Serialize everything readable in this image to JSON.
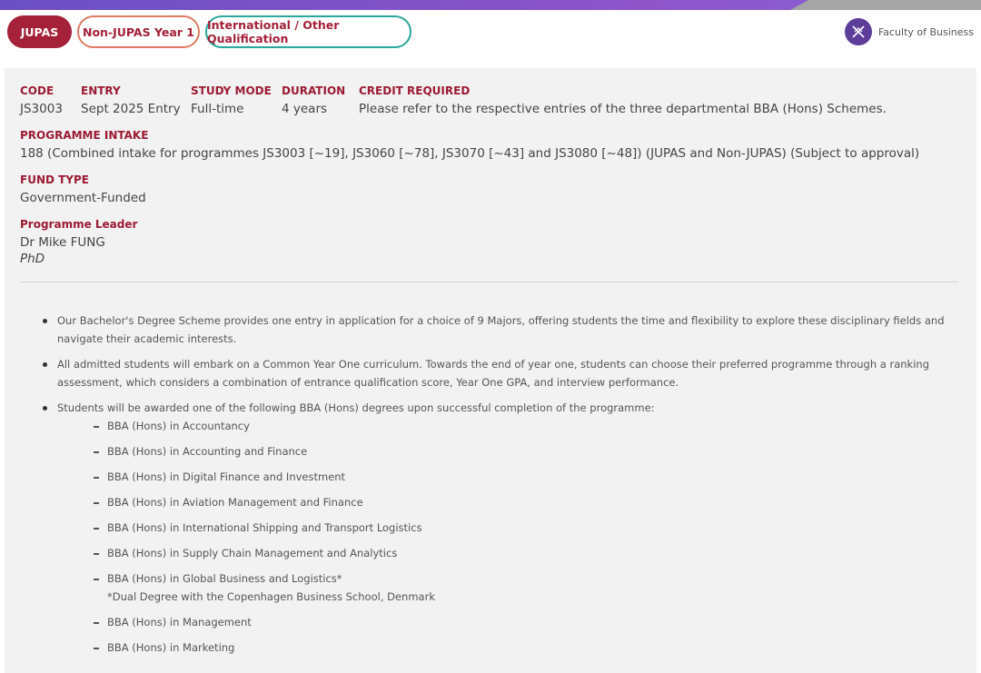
{
  "tabs": [
    {
      "label": "JUPAS"
    },
    {
      "label": "Non-JUPAS Year 1"
    },
    {
      "label": "International / Other Qualification"
    }
  ],
  "faculty": {
    "name": "Faculty of Business"
  },
  "programme": {
    "code_label": "CODE",
    "code": "JS3003",
    "entry_label": "ENTRY",
    "entry": "Sept 2025 Entry",
    "mode_label": "STUDY MODE",
    "mode": "Full-time",
    "duration_label": "DURATION",
    "duration": "4 years",
    "credit_label": "CREDIT REQUIRED",
    "credit": "Please refer to the respective entries of the three departmental BBA (Hons) Schemes.",
    "intake_label": "PROGRAMME INTAKE",
    "intake": "188 (Combined intake for programmes JS3003 [~19], JS3060 [~78], JS3070 [~43] and JS3080 [~48]) (JUPAS and Non-JUPAS) (Subject to approval)",
    "fund_label": "FUND TYPE",
    "fund": "Government-Funded",
    "leader_label": "Programme Leader",
    "leader": "Dr Mike FUNG",
    "leader_title": "PhD"
  },
  "bullets": [
    "Our Bachelor's Degree Scheme provides one entry in application for a choice of 9 Majors, offering students the time and flexibility to explore these disciplinary fields and navigate their academic interests.",
    "All admitted students will embark on a Common Year One curriculum. Towards the end of year one, students can choose their preferred programme through a ranking assessment, which considers a combination of entrance qualification score, Year One GPA, and interview performance.",
    "Students will be awarded one of the following BBA (Hons) degrees upon successful completion of the programme:"
  ],
  "degrees": [
    "BBA (Hons) in Accountancy",
    "BBA (Hons) in Accounting and Finance",
    "BBA (Hons) in Digital Finance and Investment",
    "BBA (Hons) in Aviation Management and Finance",
    "BBA (Hons) in International Shipping and Transport Logistics",
    "BBA (Hons) in Supply Chain Management and Analytics",
    "BBA (Hons) in Global Business and Logistics*",
    "BBA (Hons) in Management",
    "BBA (Hons) in Marketing"
  ],
  "degree_note": "*Dual Degree with the Copenhagen Business School, Denmark",
  "colors": {
    "accent": "#9b1b33",
    "tab_active": "#a52039",
    "tab2_border": "#e07a5f",
    "tab3_border": "#2aa89b",
    "faculty_logo": "#5c3d99"
  }
}
